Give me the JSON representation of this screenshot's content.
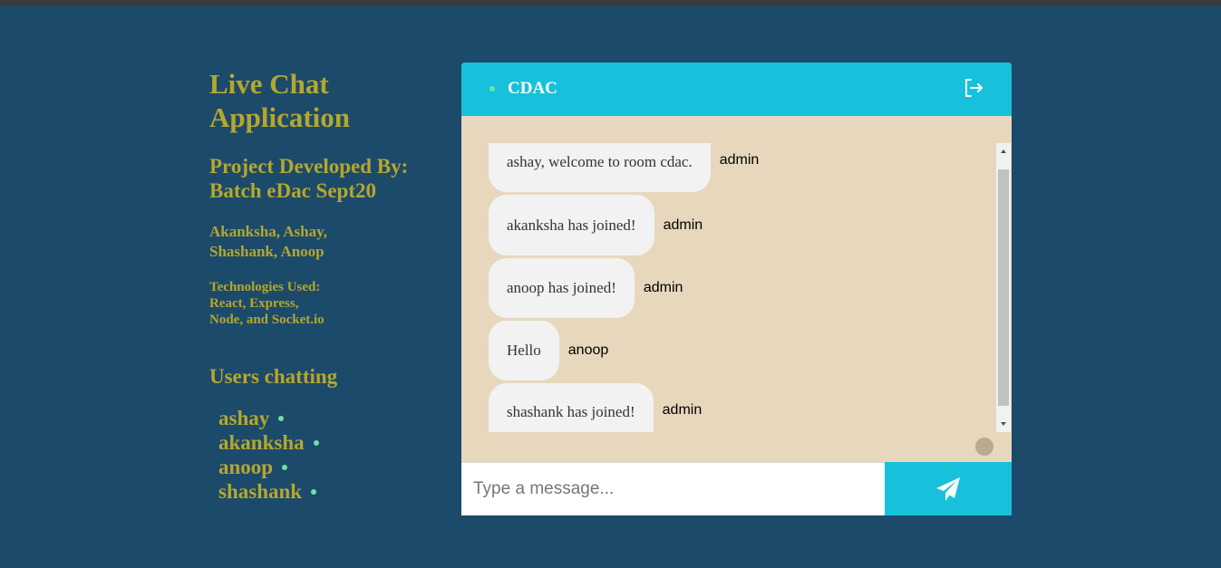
{
  "sidebar": {
    "title": "Live Chat Application",
    "developed_by_line1": "Project Developed By:",
    "developed_by_line2": "Batch eDac Sept20",
    "names_line1": "Akanksha, Ashay,",
    "names_line2": "Shashank, Anoop",
    "tech_line1": "Technologies Used:",
    "tech_line2": "React, Express,",
    "tech_line3": "Node, and Socket.io",
    "users_heading": "Users chatting",
    "users": [
      "ashay",
      "akanksha",
      "anoop",
      "shashank"
    ]
  },
  "chat": {
    "room": "CDAC",
    "logout_icon": "logout-icon",
    "messages": [
      {
        "text": "ashay, welcome to room cdac.",
        "sender": "admin"
      },
      {
        "text": "akanksha has joined!",
        "sender": "admin"
      },
      {
        "text": "anoop has joined!",
        "sender": "admin"
      },
      {
        "text": "Hello",
        "sender": "anoop"
      },
      {
        "text": "shashank has joined!",
        "sender": "admin"
      }
    ],
    "input_placeholder": "Type a message...",
    "send_icon": "paper-plane-icon"
  },
  "colors": {
    "background": "#1c4a6a",
    "sidebar_text": "#b5a72d",
    "accent": "#17c1db",
    "chat_background": "#e7d8bd",
    "bubble": "#f2f2f2",
    "online": "#6ce3a6"
  }
}
